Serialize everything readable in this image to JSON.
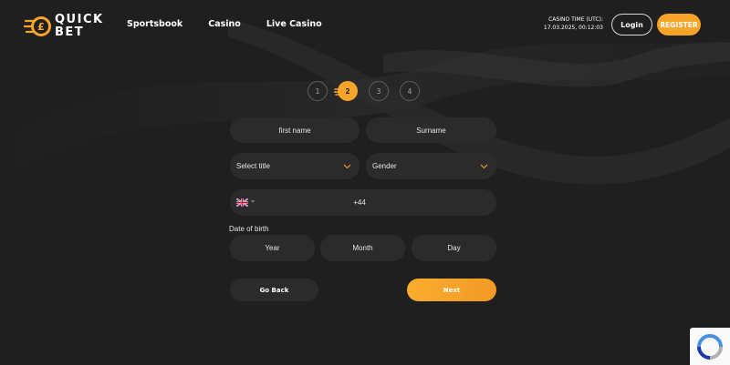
{
  "brand": {
    "line1": "QUICK",
    "line2": "BET",
    "accent": "#f7a42a"
  },
  "nav": {
    "items": [
      "Sportsbook",
      "Casino",
      "Live Casino"
    ]
  },
  "header": {
    "casino_time_label": "CASINO TIME (UTC):",
    "casino_time_value": "17.03.2025, 00:12:03",
    "login_label": "Login",
    "register_label": "REGISTER"
  },
  "steps": {
    "items": [
      "1",
      "2",
      "3",
      "4"
    ],
    "active": "2"
  },
  "form": {
    "first_name_placeholder": "first name",
    "surname_placeholder": "Surname",
    "title_select": "Select title",
    "gender_select": "Gender",
    "phone_prefix": "+44",
    "phone_flag_icon": "uk-flag-icon",
    "dob_label": "Date of birth",
    "dob_year": "Year",
    "dob_month": "Month",
    "dob_day": "Day",
    "back_label": "Go Back",
    "next_label": "Next"
  },
  "colors": {
    "background": "#1f1f1f",
    "field": "#2b2b2b",
    "accent": "#f7a42a"
  }
}
